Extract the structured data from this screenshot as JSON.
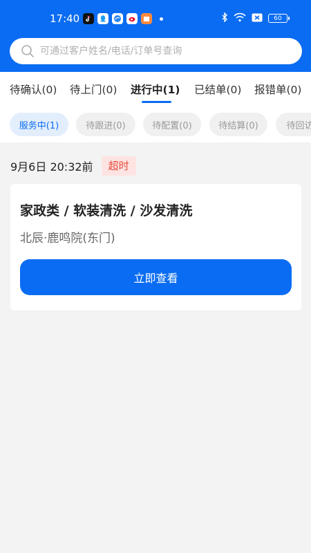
{
  "status_bar": {
    "time": "17:40",
    "battery": "60"
  },
  "search": {
    "placeholder": "可通过客户姓名/电话/订单号查询"
  },
  "tabs": [
    {
      "label": "待确认(0)"
    },
    {
      "label": "待上门(0)"
    },
    {
      "label": "进行中(1)",
      "active": true
    },
    {
      "label": "已结单(0)"
    },
    {
      "label": "报错单(0)"
    }
  ],
  "subtabs": [
    {
      "label": "服务中(1)",
      "active": true
    },
    {
      "label": "待跟进(0)"
    },
    {
      "label": "待配置(0)"
    },
    {
      "label": "待结算(0)"
    },
    {
      "label": "待回访"
    }
  ],
  "order": {
    "date": "9月6日 20:32前",
    "badge": "超时",
    "title": "家政类 / 软装清洗 / 沙发清洗",
    "address": "北辰·鹿鸣院(东门)",
    "button": "立即查看"
  },
  "colors": {
    "primary": "#0a6cf2",
    "badge_bg": "#fde4e2",
    "badge_text": "#e84b3c"
  }
}
